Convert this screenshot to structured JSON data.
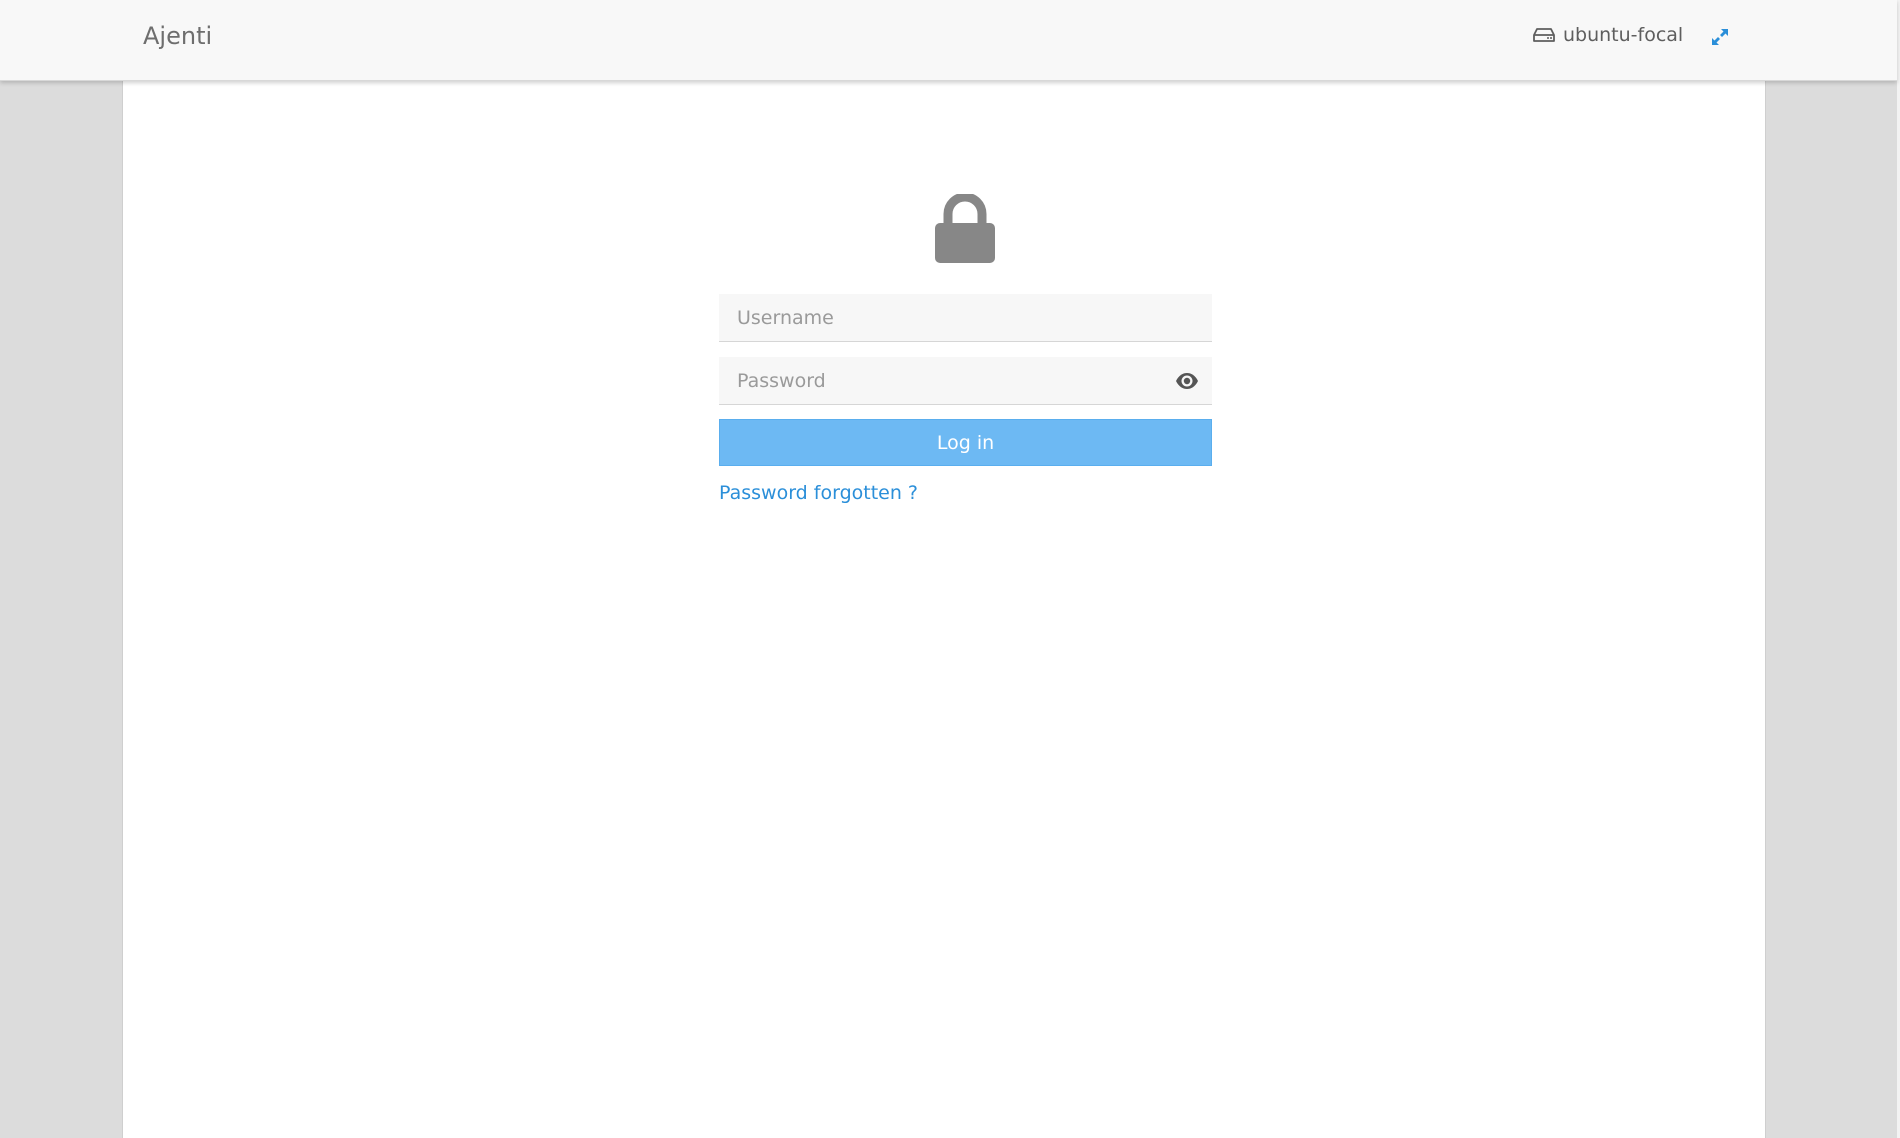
{
  "navbar": {
    "brand": "Ajenti",
    "hostname": "ubuntu-focal",
    "hostname_icon": "hard-drive-icon",
    "fullscreen_icon": "expand-icon"
  },
  "login": {
    "lock_icon": "lock-icon",
    "username_placeholder": "Username",
    "username_value": "",
    "password_placeholder": "Password",
    "password_value": "",
    "show_password_icon": "eye-icon",
    "submit_label": "Log in",
    "forgot_link": "Password forgotten ?"
  },
  "colors": {
    "accent": "#6db9f3",
    "link": "#2b8fd9",
    "navbar_bg": "#f8f8f8",
    "page_bg": "#dcdcdc"
  }
}
